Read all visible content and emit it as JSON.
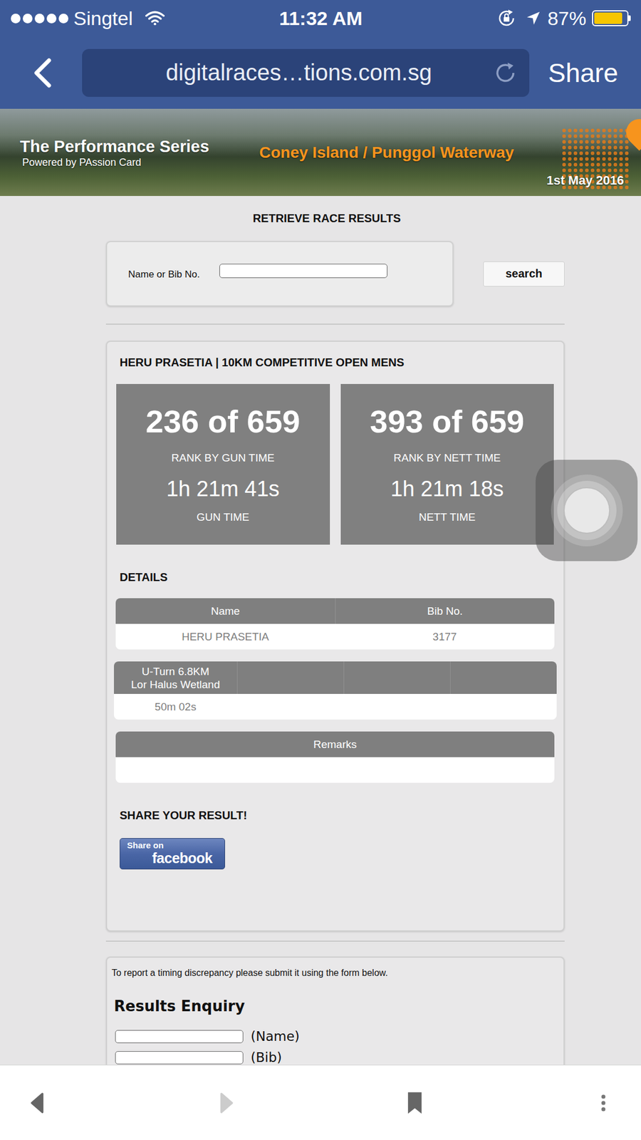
{
  "status_bar": {
    "signal": {
      "filled": 5,
      "total": 5
    },
    "carrier": "Singtel",
    "time": "11:32 AM",
    "battery": "87%",
    "battery_level": 0.87
  },
  "browser": {
    "url": "digitalraces…tions.com.sg",
    "share": "Share"
  },
  "banner": {
    "series": "The Performance Series",
    "powered_by": "Powered by PAssion Card",
    "venue": "Coney Island / Punggol Waterway",
    "date": "1st May 2016"
  },
  "page_title": "RETRIEVE RACE RESULTS",
  "search": {
    "label": "Name or Bib No.",
    "value": "",
    "button": "search"
  },
  "result": {
    "title": "HERU PRASETIA | 10KM COMPETITIVE OPEN MENS",
    "stats": [
      {
        "rank": "236 of 659",
        "rank_label": "RANK BY GUN TIME",
        "time": "1h 21m 41s",
        "time_label": "GUN TIME"
      },
      {
        "rank": "393 of 659",
        "rank_label": "RANK BY NETT TIME",
        "time": "1h 21m 18s",
        "time_label": "NETT TIME"
      }
    ],
    "details_heading": "DETAILS",
    "details": {
      "columns": [
        "Name",
        "Bib No."
      ],
      "row": [
        "HERU PRASETIA",
        "3177"
      ]
    },
    "splits": {
      "columns": [
        {
          "lines": [
            "U-Turn 6.8KM",
            "Lor Halus Wetland"
          ]
        },
        {
          "lines": []
        },
        {
          "lines": []
        },
        {
          "lines": []
        }
      ],
      "values": [
        "50m 02s",
        "",
        "",
        ""
      ]
    },
    "remarks": {
      "header": "Remarks",
      "value": ""
    },
    "share_heading": "SHARE YOUR RESULT!",
    "share_button": {
      "small": "Share on",
      "big": "facebook"
    }
  },
  "enquiry": {
    "note": "To report a timing discrepancy please submit it using the form below.",
    "title": "Results Enquiry",
    "fields": [
      {
        "label": "(Name)",
        "value": ""
      },
      {
        "label": "(Bib)",
        "value": ""
      }
    ]
  },
  "toolbar": {
    "buttons": [
      {
        "kind": "back",
        "disabled": false
      },
      {
        "kind": "forward",
        "disabled": true
      },
      {
        "kind": "bookmarks",
        "disabled": false
      },
      {
        "kind": "more",
        "disabled": false
      }
    ]
  }
}
